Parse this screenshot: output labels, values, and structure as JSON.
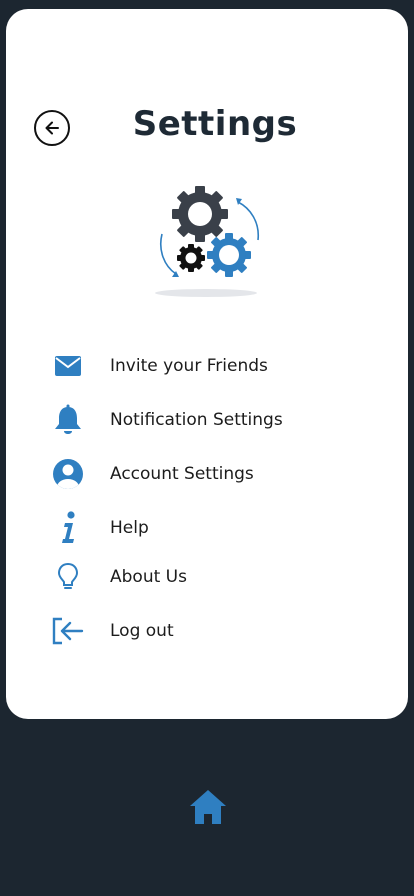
{
  "header": {
    "title": "Settings"
  },
  "menu": {
    "items": [
      {
        "label": "Invite your Friends",
        "icon": "envelope-icon"
      },
      {
        "label": "Notification Settings",
        "icon": "bell-icon"
      },
      {
        "label": "Account Settings",
        "icon": "user-circle-icon"
      },
      {
        "label": "Help",
        "icon": "info-icon"
      },
      {
        "label": "About Us",
        "icon": "lightbulb-icon"
      },
      {
        "label": "Log out",
        "icon": "logout-icon"
      }
    ]
  },
  "bottom_nav": {
    "home_icon": "home-icon"
  },
  "colors": {
    "accent": "#2f7fc1",
    "background": "#1c2630",
    "card": "#ffffff",
    "gear_dark": "#3a4049"
  }
}
